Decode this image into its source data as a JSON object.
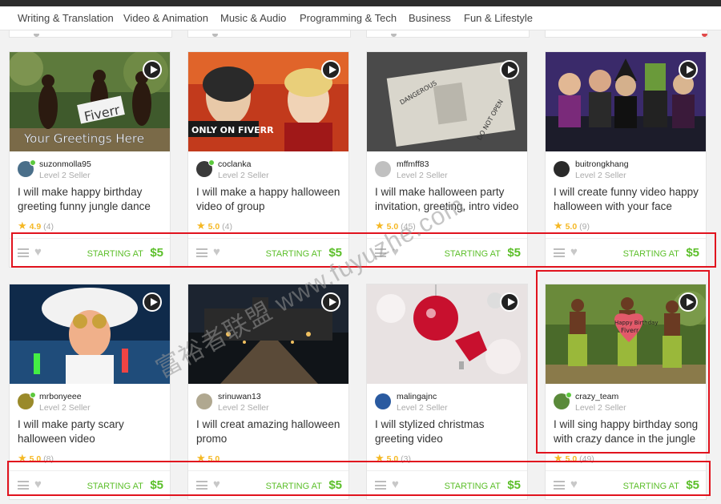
{
  "nav": {
    "items": [
      "Writing & Translation",
      "Video & Animation",
      "Music & Audio",
      "Programming & Tech",
      "Business",
      "Fun & Lifestyle"
    ]
  },
  "cards": [
    {
      "username": "suzonmolla95",
      "level": "Level 2 Seller",
      "title": "I will make happy birthday greeting funny jungle dance",
      "score": "4.9",
      "count": "(4)",
      "starting_label": "STARTING AT",
      "price": "$5",
      "thumb_text_1": "Fiverr",
      "thumb_text_2": "Your Greetings Here"
    },
    {
      "username": "coclanka",
      "level": "Level 2 Seller",
      "title": "I will make a happy halloween video of group",
      "score": "5.0",
      "count": "(4)",
      "starting_label": "STARTING AT",
      "price": "$5",
      "thumb_text_1": "ONLY ON FIVERR"
    },
    {
      "username": "mffmff83",
      "level": "Level 2 Seller",
      "title": "I will make halloween party invitation, greeting, intro video",
      "score": "5.0",
      "count": "(45)",
      "starting_label": "STARTING AT",
      "price": "$5",
      "thumb_text_1": "DANGEROUS",
      "thumb_text_2": "DO NOT OPEN"
    },
    {
      "username": "buitrongkhang",
      "level": "Level 2 Seller",
      "title": "I will create funny video happy halloween with your face",
      "score": "5.0",
      "count": "(9)",
      "starting_label": "STARTING AT",
      "price": "$5"
    },
    {
      "username": "mrbonyeee",
      "level": "Level 2 Seller",
      "title": "I will make party scary halloween video",
      "score": "5.0",
      "count": "(8)",
      "starting_label": "STARTING AT",
      "price": "$5"
    },
    {
      "username": "srinuwan13",
      "level": "Level 2 Seller",
      "title": "I will creat amazing halloween promo",
      "score": "5.0",
      "count": "",
      "starting_label": "STARTING AT",
      "price": "$5"
    },
    {
      "username": "malingajnc",
      "level": "Level 2 Seller",
      "title": "I will stylized christmas greeting video",
      "score": "5.0",
      "count": "(3)",
      "starting_label": "STARTING AT",
      "price": "$5"
    },
    {
      "username": "crazy_team",
      "level": "Level 2 Seller",
      "title": "I will sing happy birthday song with crazy dance in the jungle",
      "score": "5.0",
      "count": "(49)",
      "starting_label": "STARTING AT",
      "price": "$5",
      "thumb_text_1": "Happy Birthday",
      "thumb_text_2": "Fiverr"
    }
  ],
  "watermark": "富裕者联盟 www.fuyuzhe.com",
  "colors": {
    "accent_green": "#5cbf2a",
    "star": "#f5b824",
    "highlight": "#e1131e",
    "online": "#5cc93d"
  },
  "icons": [
    "play-icon",
    "star-icon",
    "menu-icon",
    "heart-icon"
  ]
}
